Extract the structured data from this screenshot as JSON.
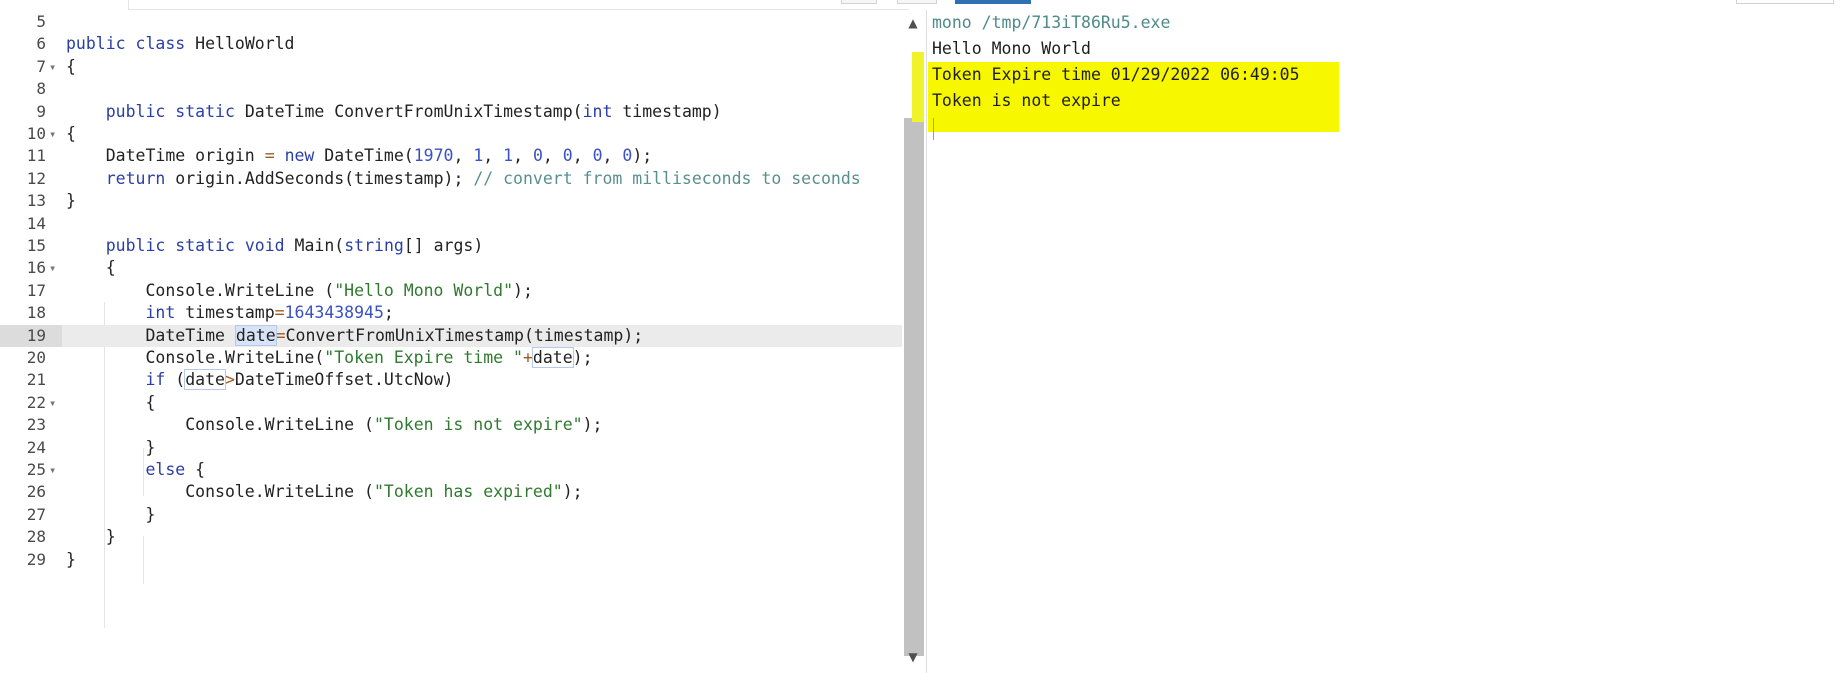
{
  "editor": {
    "lines": [
      {
        "num": "5",
        "text": ""
      },
      {
        "num": "6",
        "text": "public class HelloWorld"
      },
      {
        "num": "7",
        "text": "{"
      },
      {
        "num": "8",
        "text": ""
      },
      {
        "num": "9",
        "text": "    public static DateTime ConvertFromUnixTimestamp(int timestamp)"
      },
      {
        "num": "10",
        "text": "{"
      },
      {
        "num": "11",
        "text": "    DateTime origin = new DateTime(1970, 1, 1, 0, 0, 0, 0);"
      },
      {
        "num": "12",
        "text": "    return origin.AddSeconds(timestamp); // convert from milliseconds to seconds"
      },
      {
        "num": "13",
        "text": "}"
      },
      {
        "num": "14",
        "text": ""
      },
      {
        "num": "15",
        "text": "    public static void Main(string[] args)"
      },
      {
        "num": "16",
        "text": "    {"
      },
      {
        "num": "17",
        "text": "        Console.WriteLine (\"Hello Mono World\");"
      },
      {
        "num": "18",
        "text": "        int timestamp=1643438945;"
      },
      {
        "num": "19",
        "text": "        DateTime date=ConvertFromUnixTimestamp(timestamp);"
      },
      {
        "num": "20",
        "text": "        Console.WriteLine(\"Token Expire time \"+date);"
      },
      {
        "num": "21",
        "text": "        if (date>DateTimeOffset.UtcNow)"
      },
      {
        "num": "22",
        "text": "        {"
      },
      {
        "num": "23",
        "text": "            Console.WriteLine (\"Token is not expire\");"
      },
      {
        "num": "24",
        "text": "        }"
      },
      {
        "num": "25",
        "text": "        else {"
      },
      {
        "num": "26",
        "text": "            Console.WriteLine (\"Token has expired\");"
      },
      {
        "num": "27",
        "text": "        }"
      },
      {
        "num": "28",
        "text": "    }"
      },
      {
        "num": "29",
        "text": "}"
      }
    ],
    "active_line": "19",
    "fold_lines": [
      "7",
      "10",
      "16",
      "22",
      "25"
    ]
  },
  "console": {
    "lines": [
      "mono /tmp/713iT86Ru5.exe",
      "Hello Mono World",
      "Token Expire time 01/29/2022 06:49:05",
      "Token is not expire"
    ]
  },
  "colors": {
    "keyword": "#2a3ea8",
    "string": "#2f7a2f",
    "number": "#3a52c4",
    "comment": "#5a8f8f",
    "output_highlight": "#f7f700",
    "scrollbar_thumb": "#c1c1c1"
  },
  "icons": {
    "fold": "fold-caret-icon",
    "scroll_up": "scroll-up-arrow-icon",
    "scroll_down": "scroll-down-arrow-icon"
  }
}
